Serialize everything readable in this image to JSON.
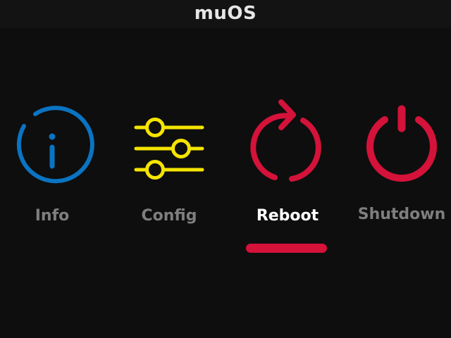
{
  "header": {
    "title": "muOS"
  },
  "menu": {
    "items": [
      {
        "label": "Info",
        "icon": "info-circle-icon",
        "color": "#0a74c2",
        "selected": false
      },
      {
        "label": "Config",
        "icon": "sliders-icon",
        "color": "#f4e400",
        "selected": false
      },
      {
        "label": "Reboot",
        "icon": "reboot-icon",
        "color": "#d4123a",
        "selected": true
      },
      {
        "label": "Shutdown",
        "icon": "power-icon",
        "color": "#d4123a",
        "selected": false
      }
    ],
    "selected_index": 2,
    "highlight_color": "#d4123a"
  }
}
